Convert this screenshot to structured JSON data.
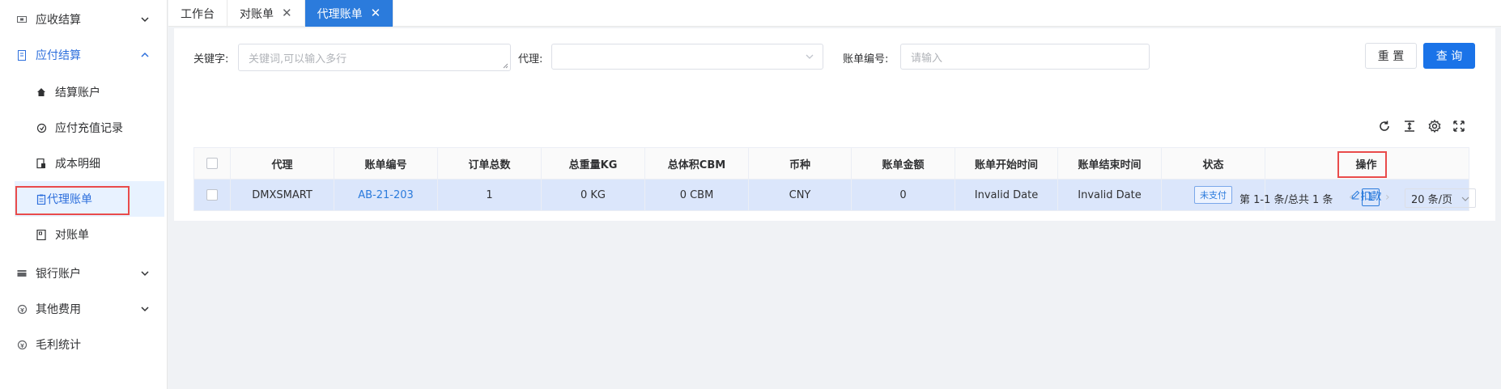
{
  "sidebar": {
    "items": [
      {
        "label": "应收结算",
        "icon": "ticket-icon"
      },
      {
        "label": "应付结算",
        "icon": "bill-icon"
      },
      {
        "label": "结算账户",
        "icon": "home-icon"
      },
      {
        "label": "应付充值记录",
        "icon": "recharge-icon"
      },
      {
        "label": "成本明细",
        "icon": "cost-icon"
      },
      {
        "label": "代理账单",
        "icon": "clipboard-icon"
      },
      {
        "label": "对账单",
        "icon": "statement-icon"
      },
      {
        "label": "银行账户",
        "icon": "card-icon"
      },
      {
        "label": "其他费用",
        "icon": "coin-icon"
      },
      {
        "label": "毛利统计",
        "icon": "coin-icon"
      }
    ]
  },
  "tabs": [
    {
      "label": "工作台",
      "closable": false
    },
    {
      "label": "对账单",
      "closable": true
    },
    {
      "label": "代理账单",
      "closable": true,
      "active": true
    }
  ],
  "search": {
    "keyword_label": "关键字:",
    "keyword_placeholder": "关键词,可以输入多行",
    "agent_label": "代理:",
    "agent_value": "",
    "bill_no_label": "账单编号:",
    "bill_no_placeholder": "请输入",
    "reset_label": "重 置",
    "query_label": "查 询"
  },
  "table": {
    "columns": [
      "代理",
      "账单编号",
      "订单总数",
      "总重量KG",
      "总体积CBM",
      "币种",
      "账单金额",
      "账单开始时间",
      "账单结束时间",
      "状态",
      "操作"
    ],
    "rows": [
      {
        "agent": "DMXSMART",
        "bill_no": "AB-21-203",
        "order_count": "1",
        "weight": "0 KG",
        "volume": "0 CBM",
        "currency": "CNY",
        "amount": "0",
        "start_time": "Invalid Date",
        "end_time": "Invalid Date",
        "status": "未支付",
        "action": "扣款"
      }
    ]
  },
  "pagination": {
    "summary": "第 1-1 条/总共 1 条",
    "current_page": "1",
    "page_size": "20 条/页"
  },
  "colors": {
    "accent": "#2b7bdc",
    "primary_button": "#1a73e8",
    "highlight_box": "#e94b4b",
    "selected_row": "#dbe6fb"
  }
}
